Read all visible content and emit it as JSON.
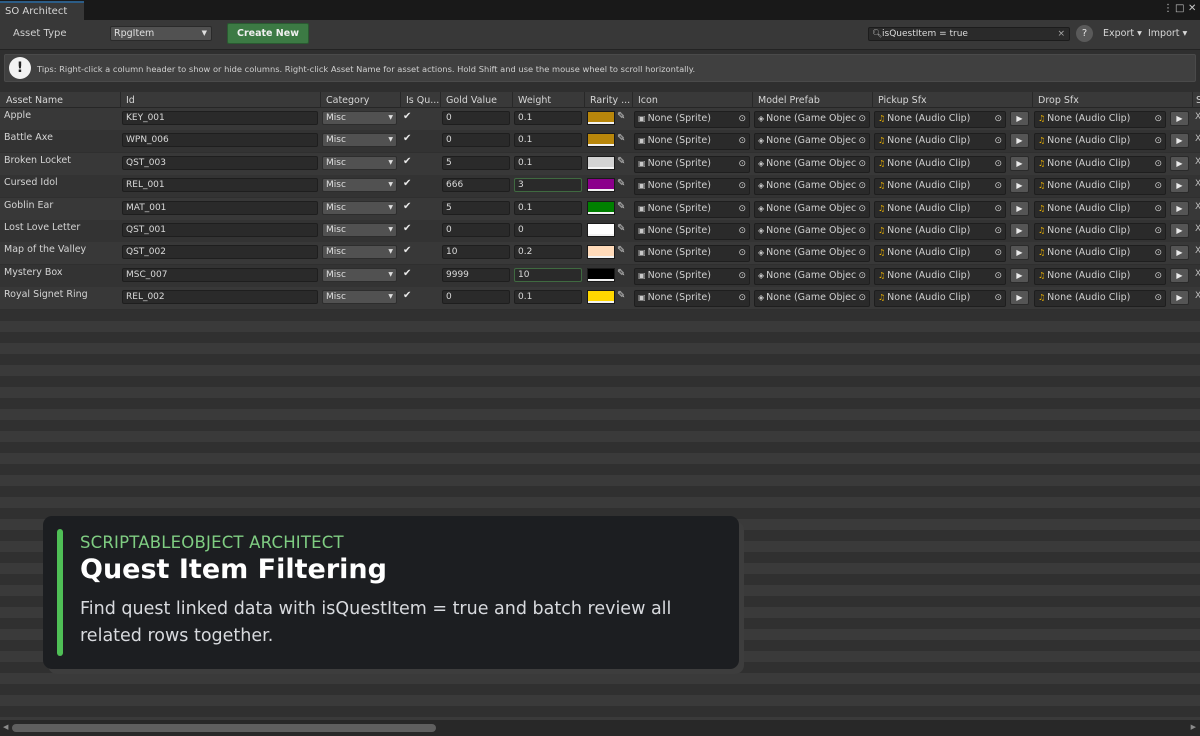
{
  "window": {
    "tab_title": "SO Architect",
    "menu_glyph": "⋮",
    "max_glyph": "□",
    "close_glyph": "✕"
  },
  "toolbar": {
    "asset_type_label": "Asset Type",
    "asset_type_value": "RpgItem",
    "create_label": "Create New",
    "search_value": "isQuestItem = true",
    "help_label": "?",
    "export_label": "Export ▾",
    "import_label": "Import ▾"
  },
  "tips": {
    "icon_glyph": "!",
    "text": "Tips: Right-click a column header to show or hide columns. Right-click Asset Name for asset actions. Hold Shift and use the mouse wheel to scroll horizontally."
  },
  "columns": {
    "asset_name": "Asset Name",
    "id": "Id",
    "category": "Category",
    "is_quest": "Is Qu...",
    "gold_value": "Gold Value",
    "weight": "Weight",
    "rarity": "Rarity ...",
    "icon": "Icon",
    "model_prefab": "Model Prefab",
    "pickup_sfx": "Pickup Sfx",
    "drop_sfx": "Drop Sfx",
    "more": "S"
  },
  "cell_glyphs": {
    "check": "✔",
    "dropdown": "▼",
    "picker": "✎",
    "target": "⊙",
    "play": "▶",
    "x": "X",
    "sprite": "▣",
    "prefab": "◈",
    "note": "♫"
  },
  "rows": [
    {
      "name": "Apple",
      "id": "KEY_001",
      "category": "Misc",
      "gold": "0",
      "weight": "0.1",
      "color": "#b8860b",
      "icon": "None (Sprite)",
      "prefab": "None (Game Objec",
      "pickup": "None (Audio Clip)",
      "drop": "None (Audio Clip)"
    },
    {
      "name": "Battle Axe",
      "id": "WPN_006",
      "category": "Misc",
      "gold": "0",
      "weight": "0.1",
      "color": "#b8860b",
      "icon": "None (Sprite)",
      "prefab": "None (Game Objec",
      "pickup": "None (Audio Clip)",
      "drop": "None (Audio Clip)"
    },
    {
      "name": "Broken Locket",
      "id": "QST_003",
      "category": "Misc",
      "gold": "5",
      "weight": "0.1",
      "color": "#d3d3d3",
      "icon": "None (Sprite)",
      "prefab": "None (Game Objec",
      "pickup": "None (Audio Clip)",
      "drop": "None (Audio Clip)"
    },
    {
      "name": "Cursed Idol",
      "id": "REL_001",
      "category": "Misc",
      "gold": "666",
      "weight": "3",
      "color": "#8b008b",
      "icon": "None (Sprite)",
      "prefab": "None (Game Objec",
      "pickup": "None (Audio Clip)",
      "drop": "None (Audio Clip)"
    },
    {
      "name": "Goblin Ear",
      "id": "MAT_001",
      "category": "Misc",
      "gold": "5",
      "weight": "0.1",
      "color": "#008000",
      "icon": "None (Sprite)",
      "prefab": "None (Game Objec",
      "pickup": "None (Audio Clip)",
      "drop": "None (Audio Clip)"
    },
    {
      "name": "Lost Love Letter",
      "id": "QST_001",
      "category": "Misc",
      "gold": "0",
      "weight": "0",
      "color": "#ffffff",
      "icon": "None (Sprite)",
      "prefab": "None (Game Objec",
      "pickup": "None (Audio Clip)",
      "drop": "None (Audio Clip)"
    },
    {
      "name": "Map of the Valley",
      "id": "QST_002",
      "category": "Misc",
      "gold": "10",
      "weight": "0.2",
      "color": "#ffdab9",
      "icon": "None (Sprite)",
      "prefab": "None (Game Objec",
      "pickup": "None (Audio Clip)",
      "drop": "None (Audio Clip)"
    },
    {
      "name": "Mystery Box",
      "id": "MSC_007",
      "category": "Misc",
      "gold": "9999",
      "weight": "10",
      "color": "#000000",
      "icon": "None (Sprite)",
      "prefab": "None (Game Objec",
      "pickup": "None (Audio Clip)",
      "drop": "None (Audio Clip)"
    },
    {
      "name": "Royal Signet Ring",
      "id": "REL_002",
      "category": "Misc",
      "gold": "0",
      "weight": "0.1",
      "color": "#ffd700",
      "icon": "None (Sprite)",
      "prefab": "None (Game Objec",
      "pickup": "None (Audio Clip)",
      "drop": "None (Audio Clip)"
    }
  ],
  "overlay": {
    "kicker": "SCRIPTABLEOBJECT ARCHITECT",
    "title": "Quest Item Filtering",
    "description": "Find quest linked data with isQuestItem = true and batch review all related rows together."
  },
  "scrollbar": {
    "left_glyph": "◀",
    "right_glyph": "▶"
  }
}
